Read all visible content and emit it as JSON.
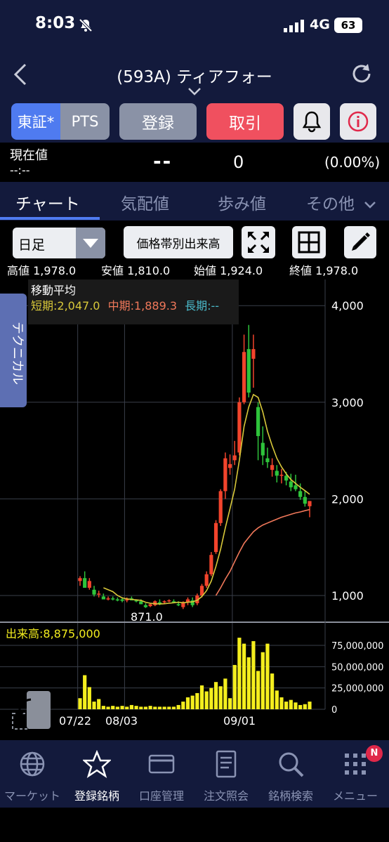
{
  "status": {
    "time": "8:03",
    "network": "4G",
    "battery": "63"
  },
  "header": {
    "title": "(593A) ティアフォー"
  },
  "buttons": {
    "tse": "東証*",
    "pts": "PTS",
    "register": "登録",
    "trade": "取引"
  },
  "price": {
    "label": "現在値",
    "time": "--:--",
    "current": "--",
    "volume": "0",
    "change": "(0.00%)"
  },
  "tabs": [
    "チャート",
    "気配値",
    "歩み値",
    "その他"
  ],
  "toolbar": {
    "period": "日足",
    "volume_profile": "価格帯別出来高"
  },
  "ohlc": {
    "high": "高値 1,978.0",
    "low": "安値 1,810.0",
    "open": "始値 1,924.0",
    "close": "終値 1,978.0"
  },
  "side_tab": "テクニカル",
  "ma": {
    "title": "移動平均",
    "short": "短期:2,047.0",
    "mid": "中期:1,889.3",
    "long": "長期:--"
  },
  "colors": {
    "accent": "#4f7bf0",
    "trade": "#f0505f",
    "up": "#f2442c",
    "down": "#2ec43b",
    "ma_short": "#d8c83a",
    "ma_mid": "#f0785a",
    "ma_long": "#4ab8c8",
    "volume": "#f4ee1e"
  },
  "chart_data": {
    "type": "candlestick",
    "price_axis": {
      "ticks": [
        "4,000",
        "3,000",
        "2,000",
        "1,000"
      ],
      "values": [
        4000,
        3000,
        2000,
        1000
      ]
    },
    "volume_axis": {
      "ticks": [
        "75,000,000",
        "50,000,000",
        "25,000,000",
        "0"
      ],
      "values": [
        75000000,
        50000000,
        25000000,
        0
      ]
    },
    "x_labels": [
      "07/22",
      "08/03",
      "09/01"
    ],
    "min_label": "871.0",
    "volume_label": "出来高:8,875,000",
    "candles": [
      [
        1150,
        1200,
        1100,
        1180
      ],
      [
        1180,
        1250,
        1130,
        1080
      ],
      [
        1080,
        1180,
        1060,
        1150
      ],
      [
        1060,
        1100,
        990,
        1010
      ],
      [
        1010,
        1050,
        980,
        1020
      ],
      [
        990,
        1020,
        960,
        960
      ],
      [
        960,
        990,
        950,
        970
      ],
      [
        970,
        990,
        950,
        960
      ],
      [
        960,
        980,
        940,
        950
      ],
      [
        960,
        980,
        930,
        945
      ],
      [
        950,
        980,
        930,
        960
      ],
      [
        970,
        990,
        950,
        950
      ],
      [
        950,
        960,
        930,
        940
      ],
      [
        940,
        960,
        910,
        910
      ],
      [
        900,
        920,
        871,
        880
      ],
      [
        890,
        920,
        880,
        910
      ],
      [
        900,
        950,
        890,
        940
      ],
      [
        930,
        960,
        900,
        910
      ],
      [
        930,
        950,
        920,
        940
      ],
      [
        950,
        960,
        930,
        950
      ],
      [
        940,
        960,
        920,
        930
      ],
      [
        910,
        940,
        890,
        900
      ],
      [
        880,
        940,
        860,
        930
      ],
      [
        930,
        980,
        900,
        960
      ],
      [
        950,
        980,
        880,
        900
      ],
      [
        920,
        1020,
        900,
        1000
      ],
      [
        1000,
        1120,
        980,
        1100
      ],
      [
        1100,
        1250,
        1080,
        1220
      ],
      [
        1220,
        1450,
        1200,
        1420
      ],
      [
        1450,
        1780,
        1430,
        1750
      ],
      [
        1750,
        2100,
        1720,
        2080
      ],
      [
        2080,
        2480,
        2000,
        2420
      ],
      [
        2320,
        2460,
        2250,
        2360
      ],
      [
        2400,
        2600,
        2350,
        2450
      ],
      [
        2480,
        3050,
        2450,
        3000
      ],
      [
        3000,
        3700,
        2980,
        3520
      ],
      [
        3550,
        3800,
        3050,
        3100
      ],
      [
        3450,
        3700,
        3150,
        3550
      ],
      [
        2950,
        3000,
        2400,
        2650
      ],
      [
        2580,
        2750,
        2350,
        2450
      ],
      [
        2420,
        2530,
        2320,
        2380
      ],
      [
        2300,
        2420,
        2230,
        2350
      ],
      [
        2290,
        2350,
        2170,
        2240
      ],
      [
        2240,
        2310,
        2160,
        2250
      ],
      [
        2240,
        2280,
        2140,
        2190
      ],
      [
        2180,
        2260,
        2080,
        2120
      ],
      [
        2140,
        2250,
        2080,
        2100
      ],
      [
        2080,
        2160,
        1990,
        2020
      ],
      [
        2020,
        2080,
        1920,
        1950
      ],
      [
        1924,
        1978,
        1810,
        1978
      ]
    ],
    "volumes_m": [
      13,
      40,
      26,
      9,
      12,
      4,
      3,
      4,
      3,
      4,
      3,
      5,
      4,
      3,
      3,
      4,
      3,
      3,
      3,
      3,
      3,
      5,
      9,
      14,
      16,
      19,
      28,
      21,
      25,
      32,
      27,
      36,
      13,
      52,
      84,
      77,
      61,
      80,
      45,
      67,
      77,
      42,
      22,
      14,
      9,
      11,
      8,
      5,
      6,
      9
    ],
    "ma_short": [
      null,
      null,
      null,
      null,
      null,
      1080,
      1060,
      1040,
      1000,
      975,
      965,
      960,
      955,
      950,
      930,
      920,
      915,
      912,
      915,
      920,
      925,
      930,
      925,
      930,
      935,
      950,
      990,
      1050,
      1150,
      1300,
      1480,
      1700,
      1900,
      2100,
      2400,
      2750,
      2950,
      3080,
      3050,
      2900,
      2700,
      2550,
      2420,
      2330,
      2260,
      2200,
      2160,
      2120,
      2085,
      2047
    ],
    "ma_mid": [
      null,
      null,
      null,
      null,
      null,
      null,
      null,
      null,
      null,
      null,
      null,
      null,
      null,
      null,
      null,
      null,
      null,
      null,
      null,
      null,
      null,
      null,
      null,
      null,
      null,
      null,
      null,
      null,
      null,
      1000,
      1080,
      1170,
      1250,
      1350,
      1450,
      1540,
      1600,
      1660,
      1700,
      1730,
      1750,
      1770,
      1790,
      1810,
      1825,
      1840,
      1855,
      1865,
      1878,
      1889.3
    ]
  },
  "bottom_nav": [
    "マーケット",
    "登録銘柄",
    "口座管理",
    "注文照会",
    "銘柄検索",
    "メニュー"
  ],
  "badge": "N"
}
